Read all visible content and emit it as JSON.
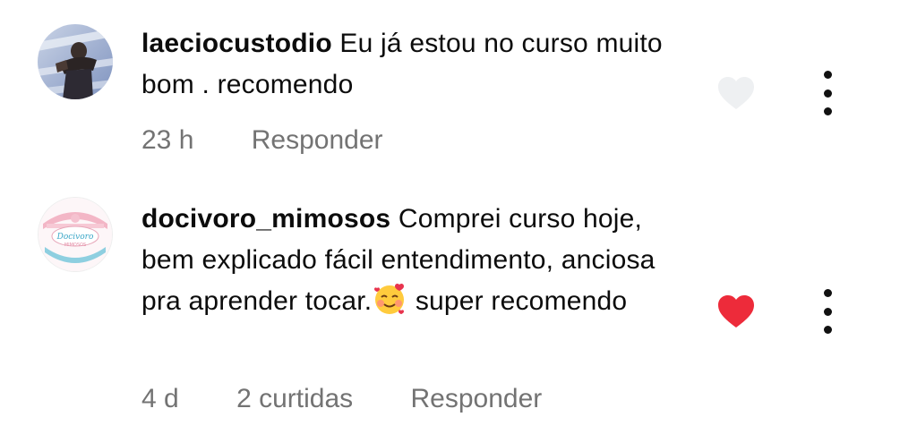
{
  "comments": [
    {
      "username": "laeciocustodio",
      "text": "Eu já estou no curso muito bom . recomendo",
      "time": "23 h",
      "likes": "",
      "reply_label": "Responder",
      "liked": false,
      "avatar_icon": "profile-photo-icon"
    },
    {
      "username": "docivoro_mimosos",
      "text_part1": "Comprei curso hoje, bem explicado fácil entendimento,  anciosa pra aprender tocar.",
      "emoji": "smiling-face-with-hearts",
      "text_part2": " super recomendo",
      "time": "4 d",
      "likes": "2 curtidas",
      "reply_label": "Responder",
      "liked": true,
      "avatar_icon": "doceria-logo-icon",
      "avatar_logo_text": "Docivoro Mimosos"
    }
  ],
  "colors": {
    "liked_heart": "#ed2b3a",
    "unliked_heart": "#eef0f2",
    "meta_text": "#737373"
  }
}
